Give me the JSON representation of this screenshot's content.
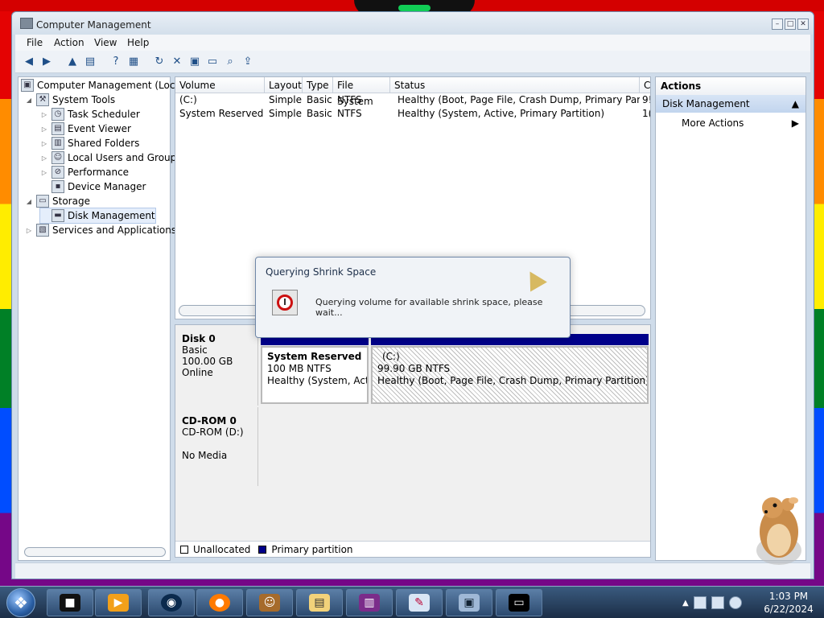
{
  "window": {
    "title": "Computer Management",
    "buttons": [
      "–",
      "□",
      "✕"
    ]
  },
  "menu": [
    "File",
    "Action",
    "View",
    "Help"
  ],
  "toolbar_icons": [
    "back-arrow-icon",
    "forward-arrow-icon",
    "up-folder-icon",
    "show-hide-tree-icon",
    "help-icon",
    "properties-view-icon",
    "refresh-icon",
    "delete-icon",
    "properties-icon",
    "open-icon",
    "search-icon",
    "export-icon"
  ],
  "tree": [
    {
      "label": "Computer Management (Local",
      "level": 0,
      "expander": "",
      "icon": "computer-icon"
    },
    {
      "label": "System Tools",
      "level": 1,
      "expander": "◢",
      "icon": "tools-icon"
    },
    {
      "label": "Task Scheduler",
      "level": 2,
      "expander": "▷",
      "icon": "clock-icon"
    },
    {
      "label": "Event Viewer",
      "level": 2,
      "expander": "▷",
      "icon": "event-viewer-icon"
    },
    {
      "label": "Shared Folders",
      "level": 2,
      "expander": "▷",
      "icon": "shared-folder-icon"
    },
    {
      "label": "Local Users and Groups",
      "level": 2,
      "expander": "▷",
      "icon": "users-icon"
    },
    {
      "label": "Performance",
      "level": 2,
      "expander": "▷",
      "icon": "performance-icon"
    },
    {
      "label": "Device Manager",
      "level": 2,
      "expander": "",
      "icon": "device-manager-icon"
    },
    {
      "label": "Storage",
      "level": 1,
      "expander": "◢",
      "icon": "storage-icon"
    },
    {
      "label": "Disk Management",
      "level": 2,
      "expander": "",
      "icon": "disk-management-icon",
      "selected": true
    },
    {
      "label": "Services and Applications",
      "level": 1,
      "expander": "▷",
      "icon": "services-icon"
    }
  ],
  "volumes": {
    "columns": [
      "Volume",
      "Layout",
      "Type",
      "File System",
      "Status",
      "C"
    ],
    "rows": [
      {
        "volume": "(C:)",
        "layout": "Simple",
        "type": "Basic",
        "fs": "NTFS",
        "status": "Healthy (Boot, Page File, Crash Dump, Primary Partition)",
        "capacity": "9!"
      },
      {
        "volume": "System Reserved",
        "layout": "Simple",
        "type": "Basic",
        "fs": "NTFS",
        "status": "Healthy (System, Active, Primary Partition)",
        "capacity": "1("
      }
    ]
  },
  "disks": [
    {
      "name": "Disk 0",
      "line1": "Basic",
      "line2": "100.00 GB",
      "line3": "Online"
    },
    {
      "name": "CD-ROM 0",
      "line1": "CD-ROM (D:)",
      "line2": "",
      "line3": "No Media"
    }
  ],
  "partitions": [
    {
      "title": "System Reserved",
      "size": "100 MB NTFS",
      "status": "Healthy (System, Active"
    },
    {
      "title": "(C:)",
      "size": "99.90 GB NTFS",
      "status": "Healthy (Boot, Page File, Crash Dump, Primary Partition)"
    }
  ],
  "legend": [
    {
      "label": "Unallocated",
      "color": "#000000"
    },
    {
      "label": "Primary partition",
      "color": "#00008a"
    }
  ],
  "actions": {
    "header": "Actions",
    "section": "Disk Management",
    "item": "More Actions"
  },
  "dialog": {
    "title": "Querying Shrink Space",
    "message": "Querying volume for available shrink space, please wait..."
  },
  "taskbar": {
    "time": "1:03 PM",
    "date": "6/22/2024",
    "apps": [
      "terminal-icon",
      "media-player-icon",
      "browser-globe-icon",
      "firefox-icon",
      "bonzi-box-icon",
      "folder-icon",
      "winrar-icon",
      "paint-icon",
      "network-computer-icon",
      "command-prompt-icon"
    ]
  }
}
